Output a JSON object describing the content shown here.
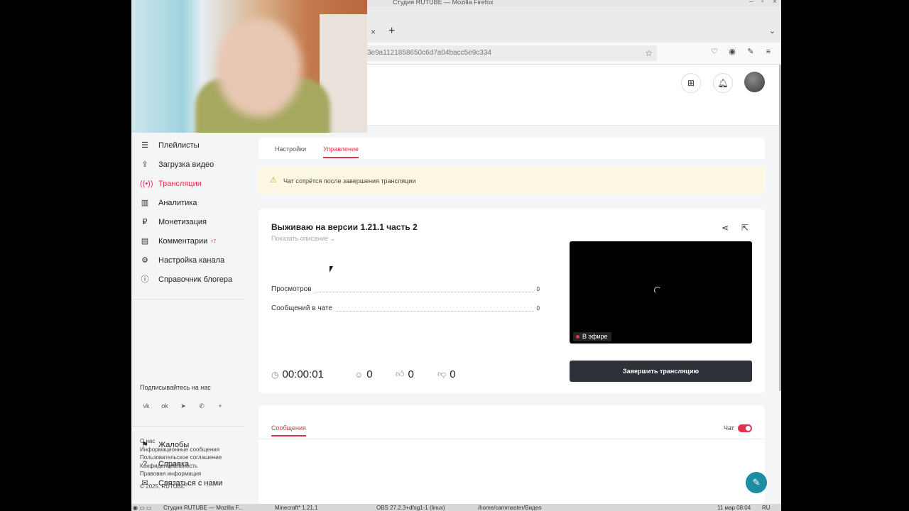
{
  "window": {
    "title": "Студия RUTUBE — Mozilla Firefox"
  },
  "browser": {
    "url": "3e9a1121858650c6d7a04bacc5e9c334",
    "new_tab": "+",
    "tab_close": "×"
  },
  "sidebar": {
    "items": [
      {
        "label": "Плейлисты",
        "icon": "playlist-icon"
      },
      {
        "label": "Загрузка видео",
        "icon": "upload-icon"
      },
      {
        "label": "Трансляции",
        "icon": "broadcast-icon",
        "active": true
      },
      {
        "label": "Аналитика",
        "icon": "analytics-icon"
      },
      {
        "label": "Монетизация",
        "icon": "ruble-icon"
      },
      {
        "label": "Комментарии",
        "icon": "comment-icon",
        "badge": "+7"
      },
      {
        "label": "Настройка канала",
        "icon": "gear-icon"
      },
      {
        "label": "Справочник блогера",
        "icon": "help-book-icon"
      }
    ],
    "follow_label": "Подписывайтесь на нас",
    "social": [
      "vk-icon",
      "ok-icon",
      "telegram-icon",
      "viber-icon",
      "plus-icon"
    ],
    "bottom_items": [
      {
        "label": "Жалобы",
        "icon": "flag-icon"
      },
      {
        "label": "Справка",
        "icon": "question-icon"
      },
      {
        "label": "Связаться с нами",
        "icon": "mail-icon"
      }
    ],
    "footer_links": [
      "О нас",
      "Информационные сообщения",
      "Пользовательское соглашение",
      "Конфиденциальность",
      "Правовая информация"
    ],
    "copyright": "© 2025, RUTUBE"
  },
  "tabs": {
    "settings": "Настройки",
    "manage": "Управление"
  },
  "warning": "Чат сотрётся после завершения трансляции",
  "stream": {
    "title": "Выживаю на версии 1.21.1 часть 2",
    "show_description": "Показать описание",
    "stats": [
      {
        "label": "Просмотров",
        "value": "0"
      },
      {
        "label": "Сообщений в чате",
        "value": "0"
      }
    ],
    "live_label": "В эфире",
    "duration": "00:00:01",
    "viewers": "0",
    "likes": "0",
    "dislikes": "0",
    "end_button": "Завершить трансляцию"
  },
  "chat": {
    "tab_label": "Сообщения",
    "toggle_label": "Чат",
    "enabled": true
  },
  "taskbar": {
    "items": [
      "Студия RUTUBE — Mozilla F...",
      "Minecraft* 1.21.1",
      "OBS 27.2.3+dfsg1-1 (linux)",
      "/home/cammaster/Видео"
    ],
    "clock": "11 мар 08:04",
    "lang": "RU"
  },
  "colors": {
    "accent": "#e0324f",
    "dark_button": "#2e3238",
    "support": "#1d8da3"
  }
}
